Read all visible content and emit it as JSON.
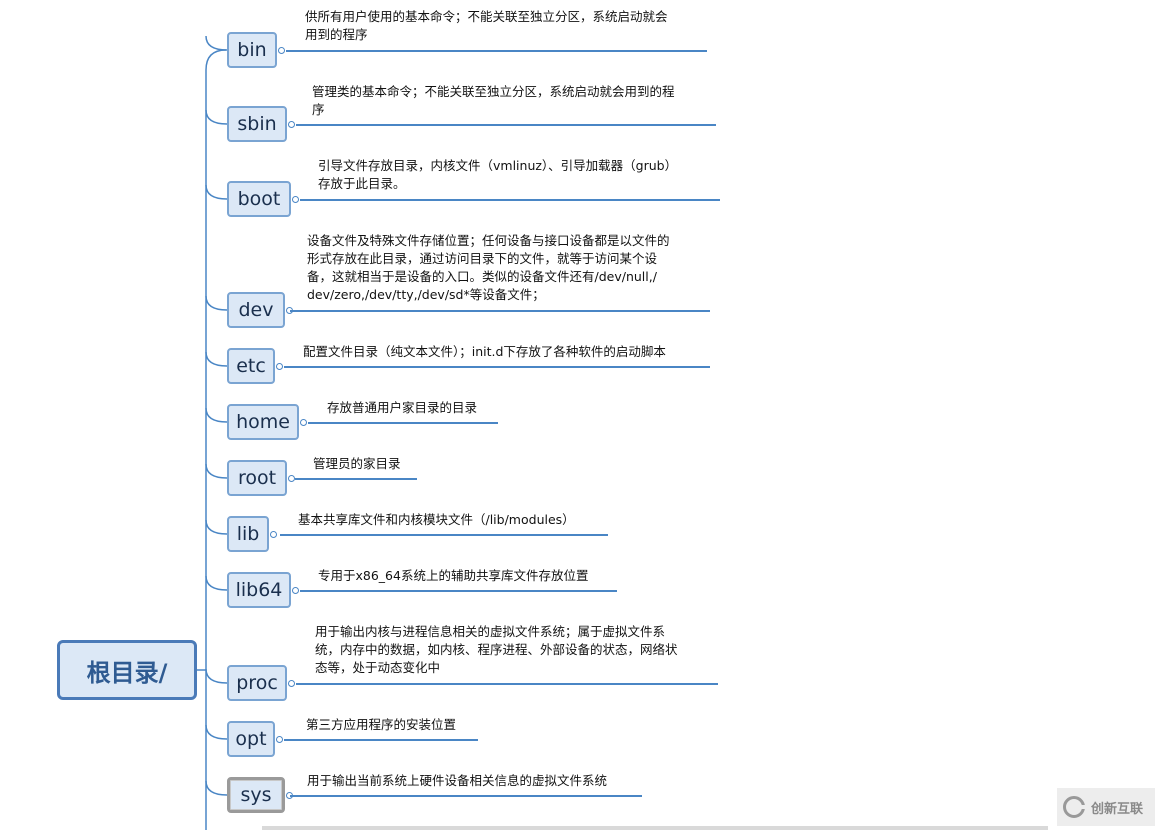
{
  "root": {
    "label": "根目录/"
  },
  "branches": [
    {
      "name": "bin",
      "desc": [
        "供所有用户使用的基本命令；不能关联至独立分区，系统启动就会",
        "用到的程序"
      ]
    },
    {
      "name": "sbin",
      "desc": [
        "管理类的基本命令；不能关联至独立分区，系统启动就会用到的程",
        "序"
      ]
    },
    {
      "name": "boot",
      "desc": [
        "引导文件存放目录，内核文件（vmlinuz）、引导加载器（grub）",
        "存放于此目录。"
      ]
    },
    {
      "name": "dev",
      "desc": [
        "设备文件及特殊文件存储位置；任何设备与接口设备都是以文件的",
        "形式存放在此目录，通过访问目录下的文件，就等于访问某个设",
        "备，这就相当于是设备的入口。类似的设备文件还有/dev/null,/",
        "dev/zero,/dev/tty,/dev/sd*等设备文件；"
      ]
    },
    {
      "name": "etc",
      "desc": [
        "配置文件目录（纯文本文件）；init.d下存放了各种软件的启动脚本"
      ]
    },
    {
      "name": "home",
      "desc": [
        "存放普通用户家目录的目录"
      ]
    },
    {
      "name": "root",
      "desc": [
        "管理员的家目录"
      ]
    },
    {
      "name": "lib",
      "desc": [
        "基本共享库文件和内核模块文件（/lib/modules）"
      ]
    },
    {
      "name": "lib64",
      "desc": [
        "专用于x86_64系统上的辅助共享库文件存放位置"
      ]
    },
    {
      "name": "proc",
      "desc": [
        "用于输出内核与进程信息相关的虚拟文件系统；属于虚拟文件系",
        "统，内存中的数据，如内核、程序进程、外部设备的状态，网络状",
        "态等，处于动态变化中"
      ]
    },
    {
      "name": "opt",
      "desc": [
        "第三方应用程序的安装位置"
      ]
    },
    {
      "name": "sys",
      "desc": [
        "用于输出当前系统上硬件设备相关信息的虚拟文件系统"
      ],
      "selected": true
    }
  ],
  "watermark": {
    "text": "创新互联",
    "icon": "logo-icon"
  },
  "colors": {
    "line": "#4a86c5",
    "node_fill": "#dce8f6",
    "node_border": "#7aa4d2",
    "root_border": "#4a7ab8"
  }
}
